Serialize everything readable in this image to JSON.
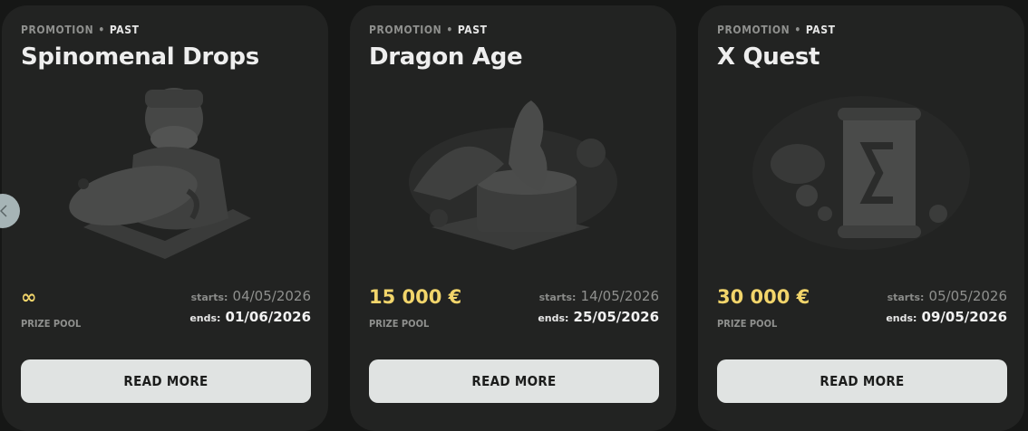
{
  "promotions": [
    {
      "tag": "PROMOTION",
      "status": "PAST",
      "title": "Spinomenal Drops",
      "prize": "∞",
      "prize_label": "PRIZE POOL",
      "starts_label": "starts:",
      "starts": "04/05/2026",
      "ends_label": "ends:",
      "ends": "01/06/2026",
      "button": "READ MORE",
      "art_icon": "fisherman-with-fish-icon"
    },
    {
      "tag": "PROMOTION",
      "status": "PAST",
      "title": "Dragon Age",
      "prize": "15 000 €",
      "prize_label": "PRIZE POOL",
      "starts_label": "starts:",
      "starts": "14/05/2026",
      "ends_label": "ends:",
      "ends": "25/05/2026",
      "button": "READ MORE",
      "art_icon": "dragon-treasure-chest-icon"
    },
    {
      "tag": "PROMOTION",
      "status": "PAST",
      "title": "X Quest",
      "prize": "30 000 €",
      "prize_label": "PRIZE POOL",
      "starts_label": "starts:",
      "starts": "05/05/2026",
      "ends_label": "ends:",
      "ends": "09/05/2026",
      "button": "READ MORE",
      "art_icon": "scroll-treasure-icon"
    }
  ],
  "nav": {
    "prev_icon": "chevron-left-icon"
  },
  "colors": {
    "background": "#161716",
    "card": "#222322",
    "prize": "#f2d56b",
    "button": "#e0e3e2"
  }
}
